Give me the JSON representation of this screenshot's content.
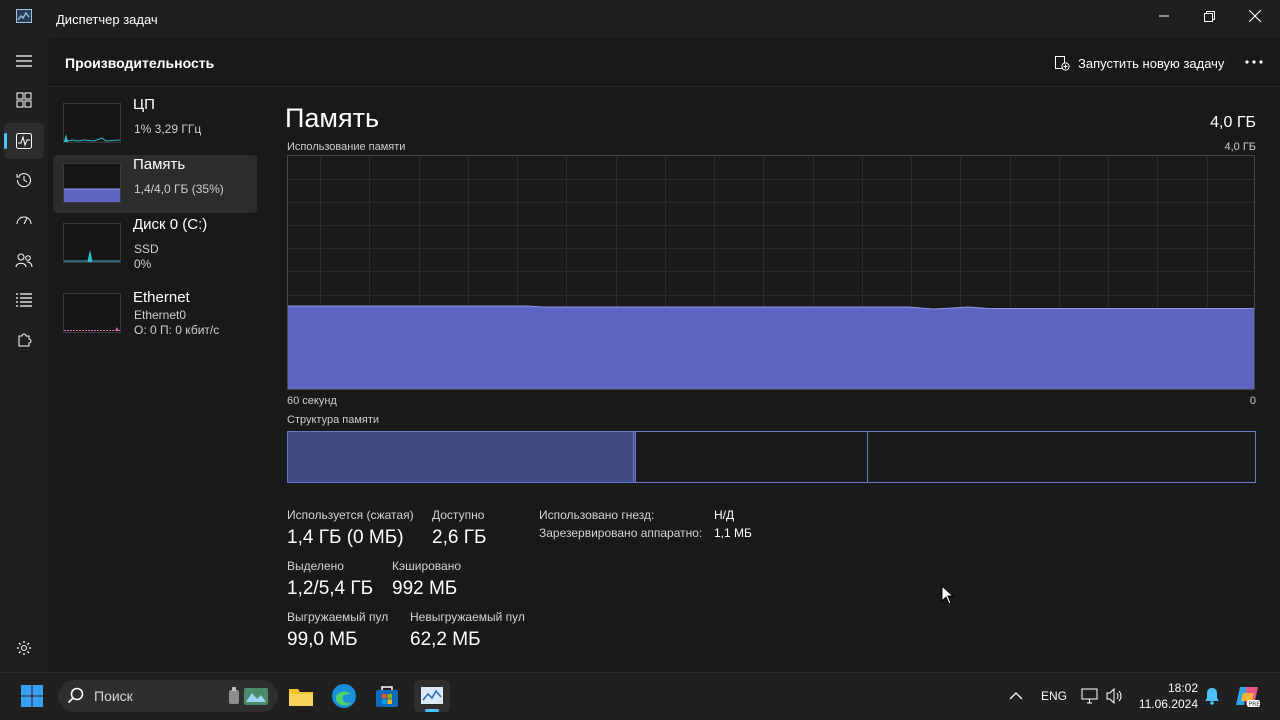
{
  "window": {
    "title": "Диспетчер задач",
    "icon": "task-manager-icon",
    "controls": [
      "minimize-icon",
      "maximize-icon",
      "close-icon"
    ]
  },
  "nav": {
    "items": [
      {
        "name": "hamburger-menu",
        "icon": "menu-icon"
      },
      {
        "name": "processes",
        "icon": "processes-icon"
      },
      {
        "name": "performance",
        "icon": "performance-icon",
        "active": true
      },
      {
        "name": "app-history",
        "icon": "history-icon"
      },
      {
        "name": "startup-apps",
        "icon": "speedometer-icon"
      },
      {
        "name": "users",
        "icon": "users-icon"
      },
      {
        "name": "details",
        "icon": "list-icon"
      },
      {
        "name": "services",
        "icon": "puzzle-icon"
      },
      {
        "name": "settings",
        "icon": "gear-icon"
      }
    ]
  },
  "header": {
    "title": "Производительность",
    "run_task_label": "Запустить новую задачу",
    "more_icon": "more-icon"
  },
  "devices": [
    {
      "name": "ЦП",
      "sub1": "1% 3,29 ГГц",
      "sub2": ""
    },
    {
      "name": "Память",
      "sub1": "1,4/4,0 ГБ (35%)",
      "sub2": "",
      "active": true
    },
    {
      "name": "Диск 0 (C:)",
      "sub1": "SSD",
      "sub2": "0%"
    },
    {
      "name": "Ethernet",
      "sub1": "Ethernet0",
      "sub2": "О: 0 П: 0 кбит/с"
    }
  ],
  "detail": {
    "title": "Память",
    "total": "4,0 ГБ",
    "usage_label": "Использование памяти",
    "usage_max": "4,0 ГБ",
    "time_left": "60 секунд",
    "time_right": "0",
    "structure_label": "Структура памяти",
    "usage_percent": 35,
    "structure": {
      "in_use_fraction": 0.355,
      "modified_fraction": 0.003,
      "standby_fraction": 0.24
    }
  },
  "stats": {
    "in_use_label": "Используется (сжатая)",
    "in_use_value": "1,4 ГБ (0 МБ)",
    "available_label": "Доступно",
    "available_value": "2,6 ГБ",
    "committed_label": "Выделено",
    "committed_value": "1,2/5,4 ГБ",
    "cached_label": "Кэшировано",
    "cached_value": "992 МБ",
    "paged_label": "Выгружаемый пул",
    "paged_value": "99,0 МБ",
    "nonpaged_label": "Невыгружаемый пул",
    "nonpaged_value": "62,2 МБ",
    "slots_label": "Использовано гнезд:",
    "slots_value": "Н/Д",
    "hw_reserved_label": "Зарезервировано аппаратно:",
    "hw_reserved_value": "1,1 МБ"
  },
  "taskbar": {
    "search_placeholder": "Поиск",
    "apps": [
      "windows-start-icon",
      "file-explorer-icon",
      "edge-icon",
      "microsoft-store-icon",
      "task-manager-icon"
    ],
    "lang": "ENG",
    "time": "18:02",
    "date": "11.06.2024",
    "tray_icons": [
      "chevron-up-icon",
      "network-icon",
      "speaker-icon",
      "bell-icon",
      "copilot-icon"
    ]
  },
  "colors": {
    "accent": "#4cc2ff",
    "memory": "#6a73c7",
    "memory_fill": "#5c66c2",
    "cpu": "#2fb6c8",
    "ethernet": "#d46fb0"
  }
}
